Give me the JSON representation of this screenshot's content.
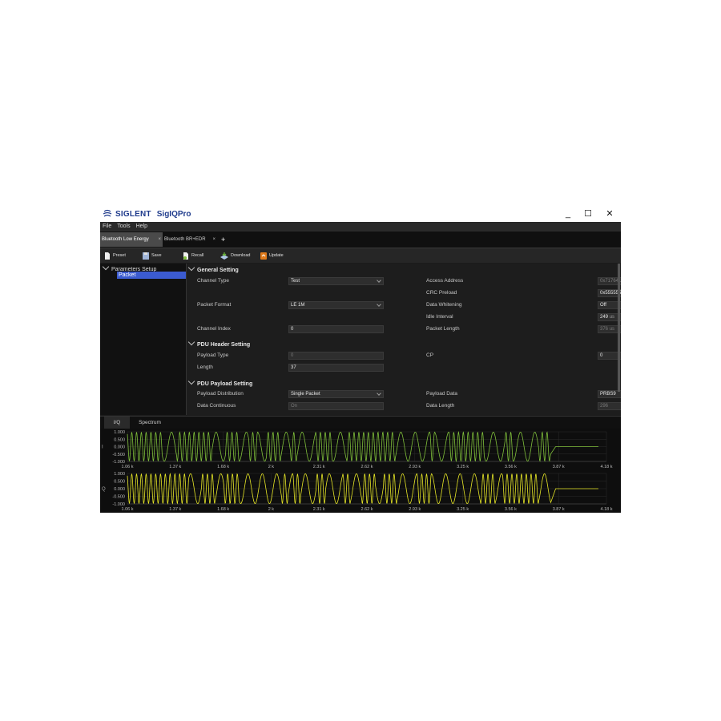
{
  "app": {
    "brand": "SIGLENT",
    "product": "SigIQPro",
    "window_controls": {
      "minimize": "_",
      "maximize": "☐",
      "close": "✕"
    }
  },
  "menu": [
    "File",
    "Tools",
    "Help"
  ],
  "tabs": [
    {
      "label": "Bluetooth Low Energy",
      "close": "×"
    },
    {
      "label": "Bluetooth BR+EDR",
      "close": "×"
    }
  ],
  "tab_add": "+",
  "toolbar": {
    "preset": "Preset",
    "save": "Save",
    "recall": "Recall",
    "download": "Download",
    "update": "Update"
  },
  "tree": {
    "root": "Parameters Setup",
    "child": "Packet"
  },
  "sections": {
    "general": "General Setting",
    "pdu_header": "PDU Header Setting",
    "pdu_payload": "PDU Payload Setting"
  },
  "fields": {
    "channel_type": {
      "label": "Channel Type",
      "value": "Test"
    },
    "packet_format": {
      "label": "Packet Format",
      "value": "LE 1M"
    },
    "channel_index": {
      "label": "Channel Index",
      "value": "0"
    },
    "access_address": {
      "label": "Access Address",
      "value": "0x71764129"
    },
    "crc_preload": {
      "label": "CRC Preload",
      "value": "0x555555"
    },
    "data_whitening": {
      "label": "Data Whitening",
      "value": "Off"
    },
    "idle_interval": {
      "label": "Idle Interval",
      "value": "249",
      "unit": "us"
    },
    "packet_length": {
      "label": "Packet Length",
      "value": "376",
      "unit": "us"
    },
    "payload_type": {
      "label": "Payload Type",
      "value": "0"
    },
    "length": {
      "label": "Length",
      "value": "37"
    },
    "cp": {
      "label": "CP",
      "value": "0"
    },
    "payload_distribution": {
      "label": "Payload Distribution",
      "value": "Single Packet"
    },
    "data_continuous": {
      "label": "Data Continuous",
      "value": "On"
    },
    "payload_data": {
      "label": "Payload Data",
      "value": "PRBS9"
    },
    "data_length": {
      "label": "Data Length",
      "value": "296"
    }
  },
  "bottom_tabs": [
    "I/Q",
    "Spectrum"
  ],
  "plot_i": {
    "axis_label": "I",
    "y_ticks": [
      "1.000",
      "0.500",
      "0.000",
      "-0.500",
      "-1.000"
    ],
    "x_ticks": [
      "1.06 k",
      "1.37 k",
      "1.68 k",
      "2 k",
      "2.31 k",
      "2.62 k",
      "2.93 k",
      "3.25 k",
      "3.56 k",
      "3.87 k",
      "4.18 k"
    ],
    "color": "#7fbf3a"
  },
  "plot_q": {
    "axis_label": "Q",
    "y_ticks": [
      "1.000",
      "0.500",
      "0.000",
      "-0.500",
      "-1.000"
    ],
    "x_ticks": [
      "1.06 k",
      "1.37 k",
      "1.68 k",
      "2 k",
      "2.31 k",
      "2.62 k",
      "2.93 k",
      "3.25 k",
      "3.56 k",
      "3.87 k",
      "4.18 k"
    ],
    "color": "#e6e626"
  },
  "colors": {
    "accent": "#3b5bd0",
    "background": "#1b1b1b",
    "brand": "#1f3b8c"
  }
}
